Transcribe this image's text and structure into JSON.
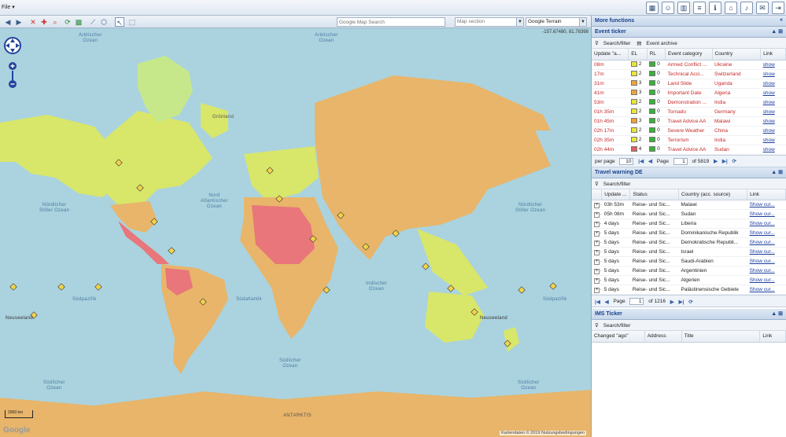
{
  "menu": {
    "file_label": "File ▾"
  },
  "toolbar": {
    "search_placeholder": "Google Map Search",
    "section_placeholder": "Map section",
    "terrain_value": "Google Terrain"
  },
  "map": {
    "coord_readout": "-157.67480, 81.78398",
    "labels": {
      "arctic": "Arktischer\nOzean",
      "arctic2": "Arktischer\nOzean",
      "npac_w": "Nördlicher\nStiller Ozean",
      "natl": "Nord\nAtlantischer\nOzean",
      "npac_e": "Nördlicher\nStiller Ozean",
      "indian": "Indischer\nOzean",
      "spac_w": "Südpazifik",
      "satl": "Südatlantik",
      "spac_e": "Südpazifik",
      "south_w": "Südlicher\nOzean",
      "south_m": "Südlicher\nOzean",
      "south_e": "Südlicher\nOzean",
      "antarktis": "ANTARKTIS",
      "gronland": "Grönland",
      "neuseeland_w": "Neuseeland",
      "neuseeland_e": "Neuseeland"
    },
    "scale_label": "2000 km",
    "google_logo": "Google",
    "attribution": "Kartendaten © 2019  Nutzungsbedingungen"
  },
  "panel": {
    "title": "More functions",
    "toggle": "«"
  },
  "event_ticker": {
    "title": "Event ticker",
    "search_label": "Search/filter",
    "archive_label": "Event archive",
    "columns": [
      "Update \"a...",
      "EL",
      "RL",
      "Event category",
      "Country",
      "Link"
    ],
    "rows": [
      {
        "update": "08m",
        "el": "2",
        "el_color": "#e8e63a",
        "rl": "0",
        "category": "Armed Conflict ...",
        "country": "Ukraine",
        "link": "show"
      },
      {
        "update": "17m",
        "el": "2",
        "el_color": "#e8e63a",
        "rl": "0",
        "category": "Technical Acci...",
        "country": "Switzerland",
        "link": "show"
      },
      {
        "update": "31m",
        "el": "3",
        "el_color": "#f0a23a",
        "rl": "0",
        "category": "Land Slide",
        "country": "Uganda",
        "link": "show"
      },
      {
        "update": "41m",
        "el": "3",
        "el_color": "#f0a23a",
        "rl": "0",
        "category": "Important Date",
        "country": "Algeria",
        "link": "show"
      },
      {
        "update": "53m",
        "el": "2",
        "el_color": "#e8e63a",
        "rl": "0",
        "category": "Demonstration ...",
        "country": "India",
        "link": "show"
      },
      {
        "update": "01h 35m",
        "el": "2",
        "el_color": "#e8e63a",
        "rl": "0",
        "category": "Tornado",
        "country": "Germany",
        "link": "show"
      },
      {
        "update": "01h 45m",
        "el": "3",
        "el_color": "#f0a23a",
        "rl": "0",
        "category": "Travel Advice AA",
        "country": "Malawi",
        "link": "show"
      },
      {
        "update": "02h 17m",
        "el": "2",
        "el_color": "#e8e63a",
        "rl": "0",
        "category": "Severe Weather",
        "country": "China",
        "link": "show"
      },
      {
        "update": "02h 35m",
        "el": "2",
        "el_color": "#e8e63a",
        "rl": "0",
        "category": "Terrorism",
        "country": "India",
        "link": "show"
      },
      {
        "update": "02h 44m",
        "el": "4",
        "el_color": "#e06060",
        "rl": "0",
        "category": "Travel Advice AA",
        "country": "Sudan",
        "link": "show"
      }
    ],
    "rl_color": "#3ab03a",
    "per_page_label": "per page",
    "per_page_value": "10",
    "page_label": "Page",
    "page_value": "1",
    "page_total": "of 5819"
  },
  "travel_warning": {
    "title": "Travel warning DE",
    "search_label": "Search/filter",
    "columns": [
      "Update ...",
      "Status",
      "Country (acc. source)",
      "Link"
    ],
    "rows": [
      {
        "update": "03h 53m",
        "status": "Reise- und Sic...",
        "country": "Malawi",
        "link": "Show cur..."
      },
      {
        "update": "05h 08m",
        "status": "Reise- und Sic...",
        "country": "Sudan",
        "link": "Show cur..."
      },
      {
        "update": "4 days",
        "status": "Reise- und Sic...",
        "country": "Liberia",
        "link": "Show cur..."
      },
      {
        "update": "5 days",
        "status": "Reise- und Sic...",
        "country": "Dominikanische Republik",
        "link": "Show cur..."
      },
      {
        "update": "5 days",
        "status": "Reise- und Sic...",
        "country": "Demokratische Republi...",
        "link": "Show cur..."
      },
      {
        "update": "5 days",
        "status": "Reise- und Sic...",
        "country": "Israel",
        "link": "Show cur..."
      },
      {
        "update": "5 days",
        "status": "Reise- und Sic...",
        "country": "Saudi-Arabien",
        "link": "Show cur..."
      },
      {
        "update": "5 days",
        "status": "Reise- und Sic...",
        "country": "Argentinien",
        "link": "Show cur..."
      },
      {
        "update": "5 days",
        "status": "Reise- und Sic...",
        "country": "Algerien",
        "link": "Show cur..."
      },
      {
        "update": "5 days",
        "status": "Reise- und Sic...",
        "country": "Palästinensische Gebiete",
        "link": "Show cur..."
      }
    ],
    "page_label": "Page",
    "page_value": "1",
    "page_total": "of 1216"
  },
  "ims_ticker": {
    "title": "IMS Ticker",
    "search_label": "Search/filter",
    "columns": [
      "Changed \"ago\"",
      "Address",
      "Title",
      "Link"
    ]
  },
  "colors": {
    "accent": "#15428b",
    "ocean": "#aad3df",
    "land_yellow": "#d8e66a",
    "land_orange": "#e8b56a",
    "land_red": "#e8767a",
    "greenland": "#c7e88a"
  }
}
